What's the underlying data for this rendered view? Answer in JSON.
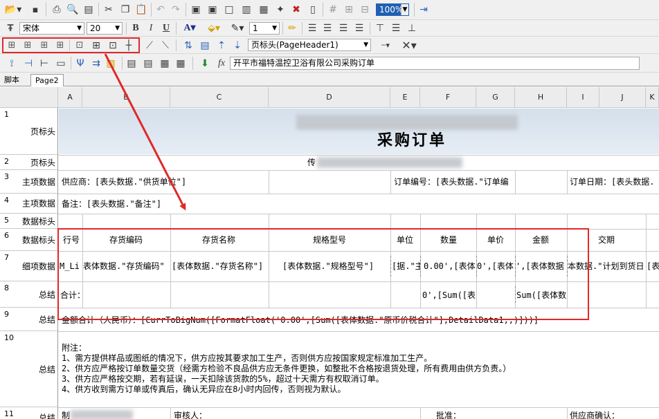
{
  "toolbar": {
    "font_name": "宋体",
    "font_size": "20",
    "zoom": "100%",
    "line_width": "1",
    "band_select": "页标头(PageHeader1)",
    "formula": "开平市福特温控卫浴有限公司采购订单"
  },
  "tabs": [
    "脚本",
    "Page2"
  ],
  "columns": [
    "A",
    "B",
    "C",
    "D",
    "E",
    "F",
    "G",
    "H",
    "I",
    "J",
    "K"
  ],
  "rows": [
    {
      "num": "1",
      "band": "页标头"
    },
    {
      "num": "2",
      "band": "页标头"
    },
    {
      "num": "3",
      "band": "主项数据"
    },
    {
      "num": "4",
      "band": "主项数据"
    },
    {
      "num": "5",
      "band": "数据标头"
    },
    {
      "num": "6",
      "band": "数据标头"
    },
    {
      "num": "7",
      "band": "细项数据"
    },
    {
      "num": "8",
      "band": "总结"
    },
    {
      "num": "9",
      "band": "总结"
    },
    {
      "num": "10",
      "band": "总结"
    },
    {
      "num": "11",
      "band": "总结"
    }
  ],
  "cells": {
    "r1_title": "采购订单",
    "r2_prefix": "传",
    "r3_supplier": "供应商：[表头数据.\"供货单位\"]",
    "r3_order_no": "订单编号：[表头数据.\"订单编",
    "r3_order_date": "订单日期：[表头数据.",
    "r4_remark": "备注：[表头数据.\"备注\"]",
    "h_line": "行号",
    "h_code": "存货编码",
    "h_name": "存货名称",
    "h_spec": "规格型号",
    "h_unit": "单位",
    "h_qty": "数量",
    "h_price": "单价",
    "h_amount": "金额",
    "h_delivery": "交期",
    "d_line": "M_Li",
    "d_code": "表体数据.\"存货编码\"",
    "d_name": "[表体数据.\"存货名称\"]",
    "d_spec": "[表体数据.\"规格型号\"]",
    "d_unit": "[据.\"主",
    "d_qty": "0.00',[表体",
    "d_price": "0',[表体",
    "d_amount": "',[表体数据",
    "d_delivery": "本数据.\"计划到货日",
    "s_total": "合计：",
    "s_qty": "0',[Sum([表",
    "s_amount": "Sum([表体数",
    "s_amount_words": "金额合计（人民币）：[CurrToBigNum([FormatFloat('0.00',[Sum([表体数据.\"原币价税合计\"],DetailData1,,)]))]",
    "notes": [
      "附注：",
      "1、需方提供样品或图纸的情况下，供方应按其要求加工生产，否则供方应按国家规定标准加工生产。",
      "2、供方应严格按订单数量交货（经需方检验不良品供方应无条件更换，如整批不合格按退货处理，所有费用由供方负责。）",
      "3、供方应严格按交期，若有延误，一天扣除该货款的5%，超过十天需方有权取消订单。",
      "4、供方收到需方订单或传真后，确认无异应在8小时内回传，否则视为默认。"
    ],
    "r11_maker": "制",
    "r11_reviewer": "审核人：",
    "r11_approve": "批准：",
    "r11_supplier_confirm": "供应商确认："
  },
  "colors": {
    "annotation": "#e02828",
    "toolbar_bg": "#f0f0f0",
    "header_band": "#dde6f0"
  }
}
